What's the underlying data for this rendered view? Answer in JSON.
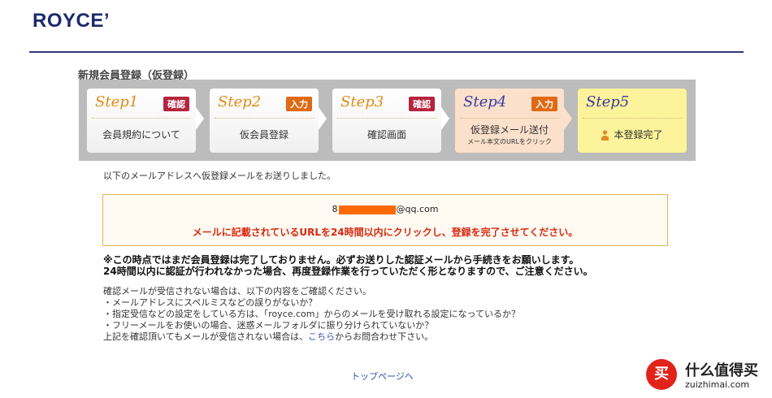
{
  "brand": {
    "logo": "ROYCE’"
  },
  "page": {
    "title": "新規会員登録（仮登録）"
  },
  "steps": [
    {
      "num": "Step1",
      "badge": "確認",
      "label": "会員規約について",
      "sub": ""
    },
    {
      "num": "Step2",
      "badge": "入力",
      "label": "仮会員登録",
      "sub": ""
    },
    {
      "num": "Step3",
      "badge": "確認",
      "label": "確認画面",
      "sub": ""
    },
    {
      "num": "Step4",
      "badge": "入力",
      "label": "仮登録メール送付",
      "sub": "メール本文のURLをクリック"
    },
    {
      "num": "Step5",
      "badge": "",
      "label": "本登録完了",
      "sub": ""
    }
  ],
  "message": {
    "sent": "以下のメールアドレスへ仮登録メールをお送りしました。",
    "email_prefix": "8",
    "email_suffix": "@qq.com",
    "alert": "メールに記載されているURLを24時間以内にクリックし、登録を完了させてください。"
  },
  "warning": {
    "line1": "※この時点ではまだ会員登録は完了しておりません。必ずお送りした認証メールから手続きをお願いします。",
    "line2": "24時間以内に認証が行われなかった場合、再度登録作業を行っていただく形となりますので、ご注意ください。"
  },
  "check": {
    "intro": "確認メールが受信されない場合は、以下の内容をご確認ください。",
    "item1": "・メールアドレスにスペルミスなどの誤りがないか？",
    "item2": "・指定受信などの設定をしている方は、「royce.com」からのメールを受け取れる設定になっているか？",
    "item3": "・フリーメールをお使いの場合、迷惑メールフォルダに振り分けられていないか？",
    "last_before": "上記を確認頂いてもメールが受信されない場合は、",
    "link": "こちら",
    "last_after": "からお問合わせ下さい。"
  },
  "nav": {
    "top_link": "トップページへ"
  },
  "watermark": {
    "icon": "买",
    "text": "什么值得买",
    "sub": "zuizhimai.com"
  },
  "colors": {
    "brand": "#1d2a6b",
    "alert": "#d62a10",
    "badge_confirm": "#b5243e",
    "badge_input": "#e06a14"
  }
}
